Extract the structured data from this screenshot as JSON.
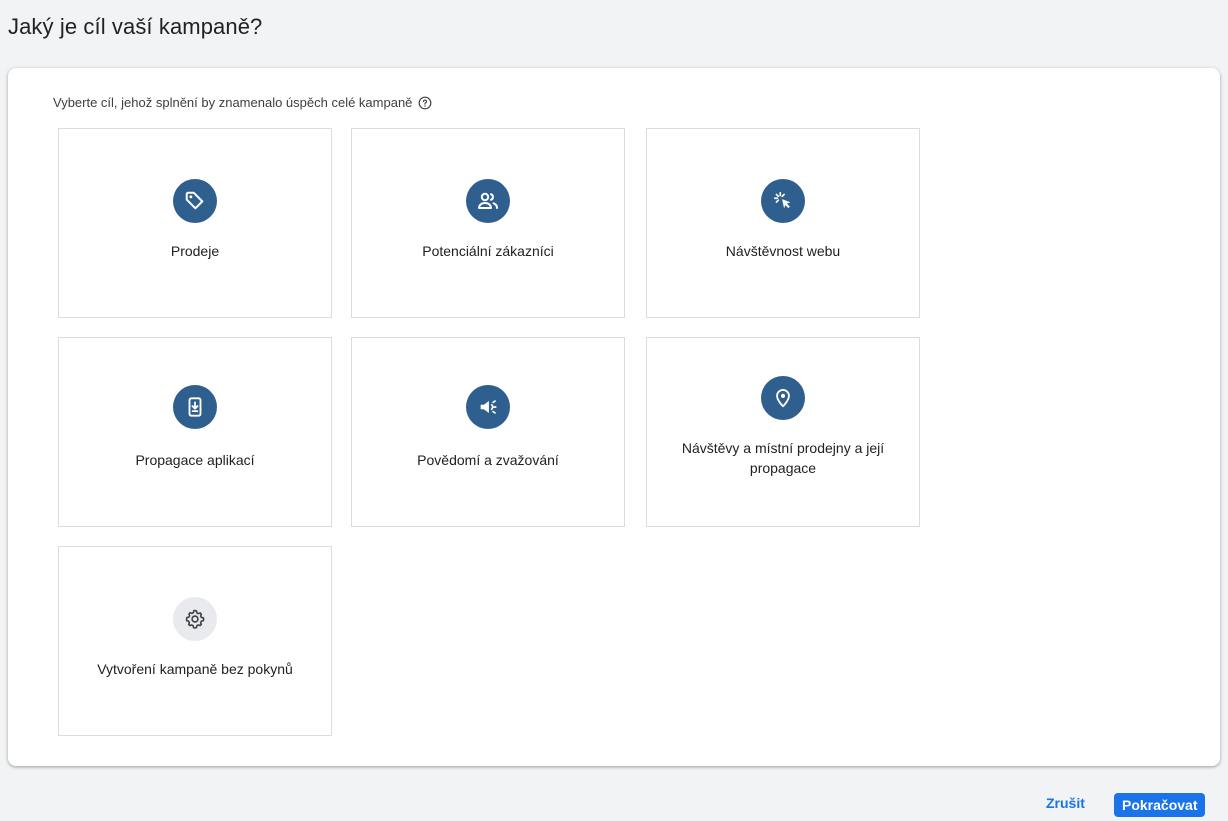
{
  "header": {
    "title": "Jaký je cíl vaší kampaně?"
  },
  "panel": {
    "subtitle": "Vyberte cíl, jehož splnění by znamenalo úspěch celé kampaně",
    "help_icon": "help-circle-icon"
  },
  "goals": [
    {
      "label": "Prodeje",
      "icon": "tag-icon"
    },
    {
      "label": "Potenciální zákazníci",
      "icon": "people-icon"
    },
    {
      "label": "Návštěvnost webu",
      "icon": "cursor-click-icon"
    },
    {
      "label": "Propagace aplikací",
      "icon": "phone-download-icon"
    },
    {
      "label": "Povědomí a zvažování",
      "icon": "megaphone-icon"
    },
    {
      "label": "Návštěvy a místní prodejny a její propagace",
      "icon": "location-pin-icon"
    },
    {
      "label": "Vytvoření kampaně bez pokynů",
      "icon": "gear-icon"
    }
  ],
  "footer": {
    "cancel_label": "Zrušit",
    "continue_label": "Pokračovat"
  },
  "colors": {
    "icon_bg": "#2f5f8f",
    "icon_bg_neutral": "#e8eaed",
    "primary": "#1a73e8"
  }
}
